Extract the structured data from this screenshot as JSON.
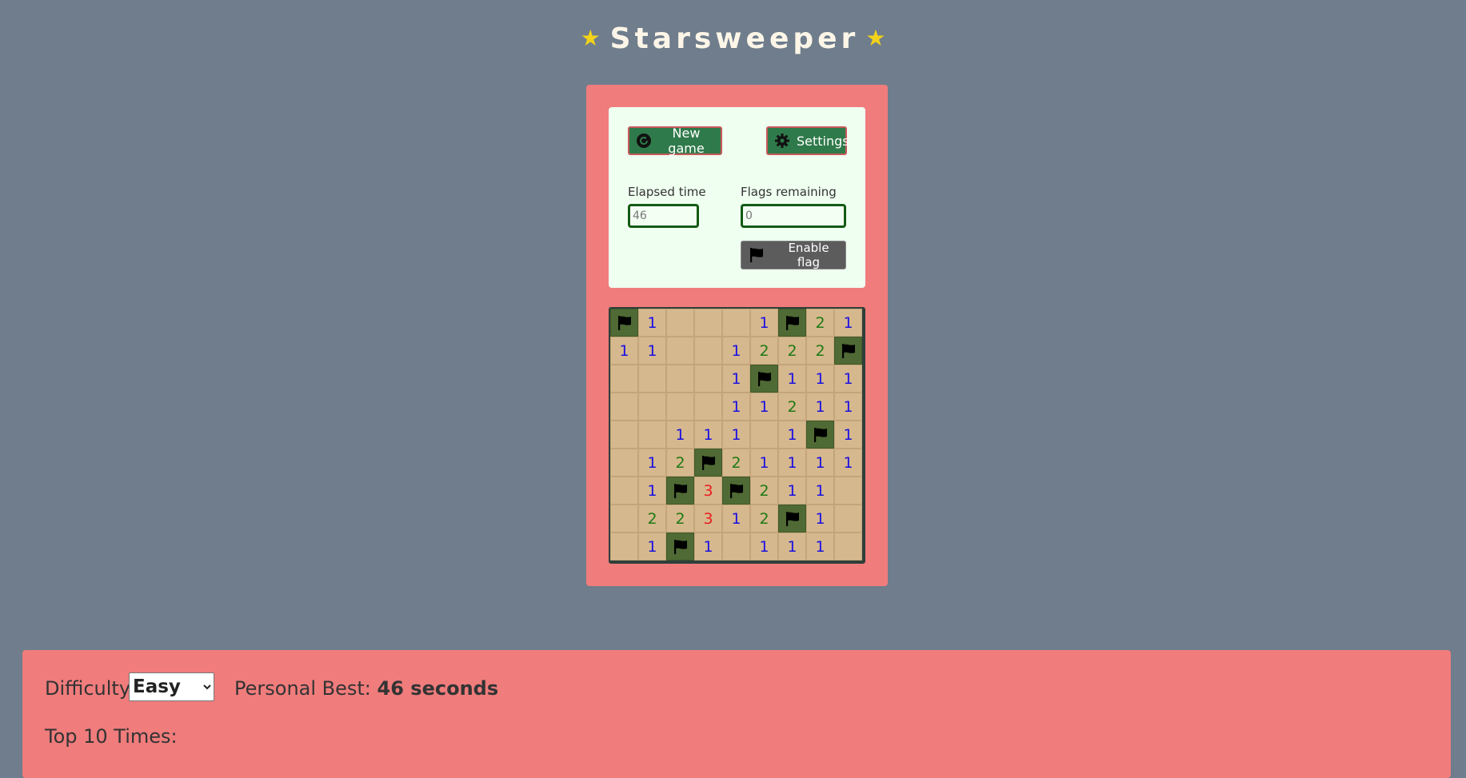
{
  "header": {
    "title": "Starsweeper",
    "star_left": "★",
    "star_right": "★"
  },
  "controls": {
    "new_game_label": "New game",
    "settings_label": "Settings",
    "elapsed_label": "Elapsed time",
    "elapsed_value": "46",
    "flags_label": "Flags remaining",
    "flags_value": "0",
    "enable_flag_label": "Enable flag"
  },
  "board": {
    "rows": [
      [
        "F",
        "1",
        "",
        "",
        "",
        "1",
        "F",
        "2",
        "1"
      ],
      [
        "1",
        "1",
        "",
        "",
        "1",
        "2",
        "2",
        "2",
        "F"
      ],
      [
        "",
        "",
        "",
        "",
        "1",
        "F",
        "1",
        "1",
        "1"
      ],
      [
        "",
        "",
        "",
        "",
        "1",
        "1",
        "2",
        "1",
        "1"
      ],
      [
        "",
        "",
        "1",
        "1",
        "1",
        "",
        "1",
        "F",
        "1"
      ],
      [
        "",
        "1",
        "2",
        "F",
        "2",
        "1",
        "1",
        "1",
        "1"
      ],
      [
        "",
        "1",
        "F",
        "3",
        "F",
        "2",
        "1",
        "1",
        ""
      ],
      [
        "",
        "2",
        "2",
        "3",
        "1",
        "2",
        "F",
        "1",
        ""
      ],
      [
        "",
        "1",
        "F",
        "1",
        "",
        "1",
        "1",
        "1",
        ""
      ]
    ]
  },
  "stats": {
    "difficulty_label": "Difficulty:",
    "difficulty_value": "Easy",
    "personal_best_label": "Personal Best:",
    "personal_best_value": "46 seconds",
    "top10_label": "Top 10 Times:"
  },
  "colors": {
    "background": "#6f7d8c",
    "panel": "#f07c7c",
    "button_green": "#2f7a4a",
    "tile": "#d6b88e",
    "flag_tile": "#4f6a34"
  }
}
